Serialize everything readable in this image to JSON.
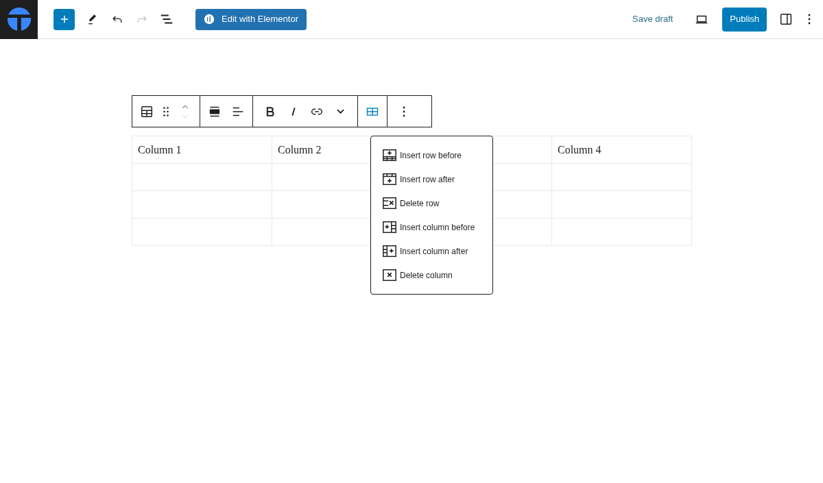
{
  "top_bar": {
    "undo_disabled": false,
    "redo_disabled": true,
    "edit_button": "Edit with Elementor",
    "save_draft": "Save draft",
    "publish": "Publish"
  },
  "block_toolbar": {
    "move_down_disabled": true,
    "table_edit_selected": true
  },
  "table": {
    "columns": [
      {
        "label": "Column 1"
      },
      {
        "label": "Column 2"
      },
      {},
      {
        "label": "Column 4"
      }
    ]
  },
  "menu": [
    {
      "label": "Insert row before"
    },
    {
      "label": "Insert row after"
    },
    {
      "label": "Delete row"
    },
    {
      "label": "Insert column before"
    },
    {
      "label": "Insert column after"
    },
    {
      "label": "Delete column"
    }
  ]
}
